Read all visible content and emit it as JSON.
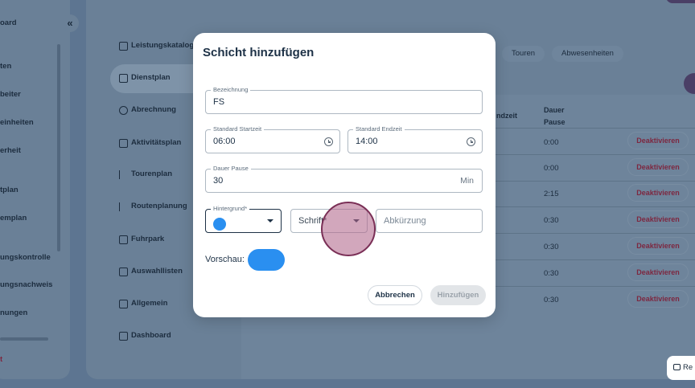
{
  "sidebar": {
    "collapse_icon": "«",
    "items": [
      {
        "label": "oard"
      },
      {
        "label": "ten"
      },
      {
        "label": "beiter"
      },
      {
        "label": "einheiten"
      },
      {
        "label": "erheit"
      },
      {
        "label": "tplan"
      },
      {
        "label": "emplan"
      },
      {
        "label": "ungskontrolle"
      },
      {
        "label": "ungsnachweis"
      },
      {
        "label": "nungen"
      }
    ],
    "logout_label": "t"
  },
  "nav": {
    "items": [
      {
        "label": "Leistungskataloge",
        "icon": "catalog-icon",
        "active": false
      },
      {
        "label": "Dienstplan",
        "icon": "calendar-icon",
        "active": true
      },
      {
        "label": "Abrechnung",
        "icon": "billing-icon",
        "active": false
      },
      {
        "label": "Aktivitätsplan",
        "icon": "calendar-icon",
        "active": false
      },
      {
        "label": "Tourenplan",
        "icon": "flag-icon",
        "active": false
      },
      {
        "label": "Routenplanung",
        "icon": "flag-icon",
        "active": false
      },
      {
        "label": "Fuhrpark",
        "icon": "vehicle-icon",
        "active": false
      },
      {
        "label": "Auswahllisten",
        "icon": "list-icon",
        "active": false
      },
      {
        "label": "Allgemein",
        "icon": "calendar-icon",
        "active": false
      },
      {
        "label": "Dashboard",
        "icon": "dashboard-icon",
        "active": false
      }
    ]
  },
  "tabs": [
    "Touren",
    "Abwesenheiten"
  ],
  "table": {
    "headers": {
      "endzeit": "ndzeit",
      "pause_line1": "Dauer",
      "pause_line2": "Pause"
    },
    "rows": [
      {
        "pause": "0:00",
        "action": "Deaktivieren"
      },
      {
        "pause": "0:00",
        "action": "Deaktivieren"
      },
      {
        "pause": "2:15",
        "action": "Deaktivieren"
      },
      {
        "pause": "0:30",
        "action": "Deaktivieren"
      },
      {
        "pause": "0:30",
        "action": "Deaktivieren"
      },
      {
        "pause": "0:30",
        "action": "Deaktivieren"
      },
      {
        "pause": "0:30",
        "action": "Deaktivieren"
      }
    ]
  },
  "help_button_label": "Re",
  "dialog": {
    "title": "Schicht hinzufügen",
    "bezeichnung": {
      "label": "Bezeichnung",
      "value": "FS"
    },
    "start": {
      "label": "Standard Startzeit",
      "value": "06:00"
    },
    "end": {
      "label": "Standard Endzeit",
      "value": "14:00"
    },
    "pause": {
      "label": "Dauer Pause",
      "value": "30",
      "suffix": "Min"
    },
    "hintergrund": {
      "label": "Hintergrund*",
      "color": "#2a8ff0"
    },
    "schrift": {
      "placeholder": "Schrift*"
    },
    "abkuerzung": {
      "placeholder": "Abkürzung"
    },
    "preview": {
      "label": "Vorschau:",
      "color": "#2a8ff0"
    },
    "cancel_label": "Abbrechen",
    "submit_label": "Hinzufügen"
  },
  "colors": {
    "accent": "#2a8ff0",
    "danger": "#7d2740",
    "overlay": "#5d7591"
  }
}
